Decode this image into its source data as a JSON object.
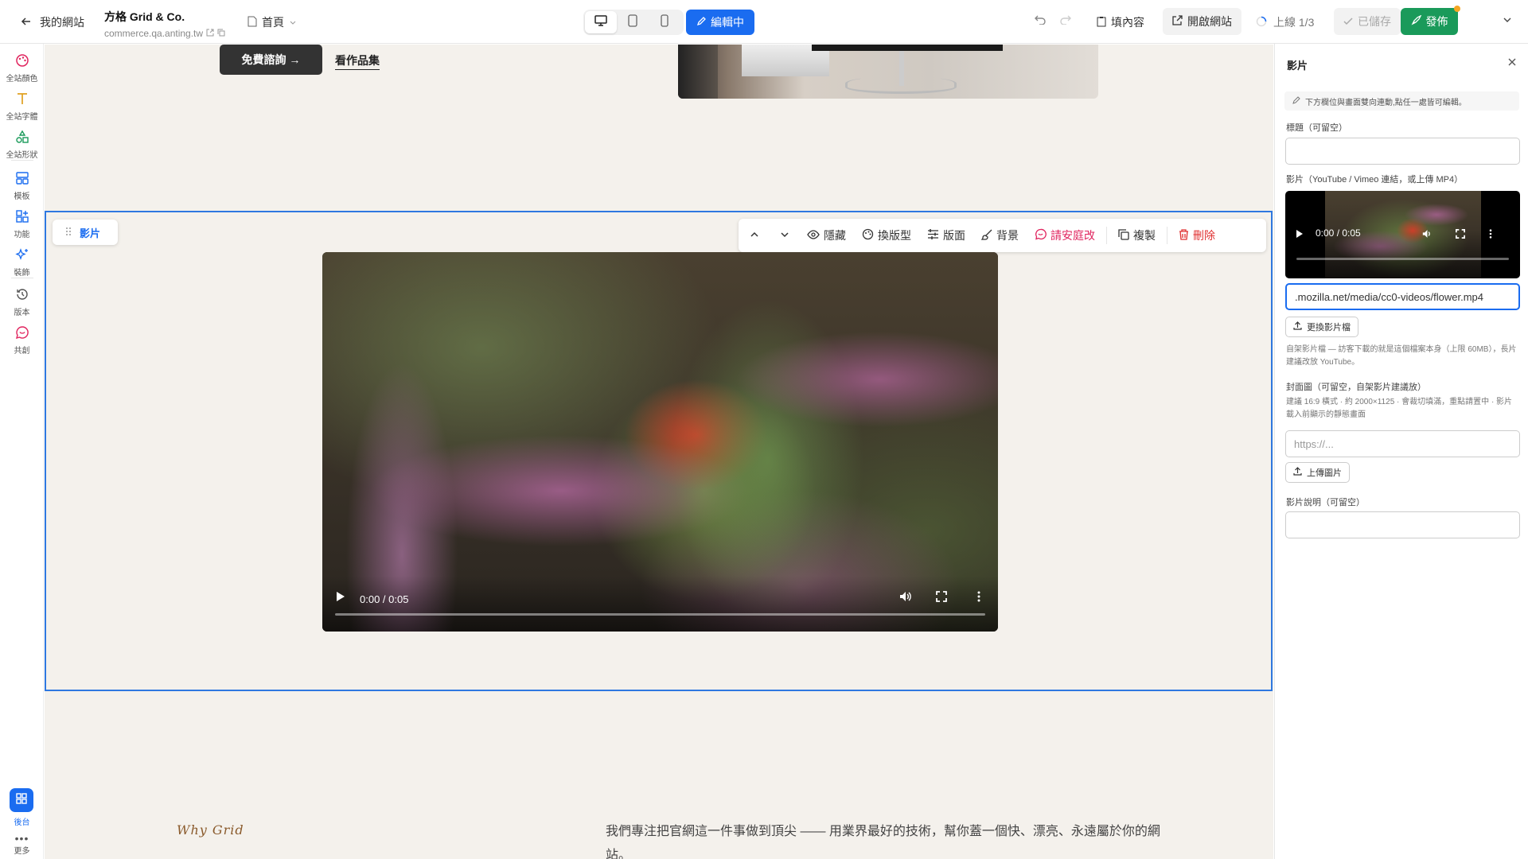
{
  "topbar": {
    "back_label": "我的網站",
    "site_name": "方格 Grid & Co.",
    "site_url": "commerce.qa.anting.tw",
    "page_label": "首頁",
    "edit_label": "編輯中",
    "fill_label": "填內容",
    "open_label": "開啟網站",
    "online_label": "上線 1/3",
    "saved_label": "已儲存",
    "publish_label": "發佈"
  },
  "sidebar": {
    "items": [
      {
        "label": "全站顏色",
        "icon": "palette-icon"
      },
      {
        "label": "全站字體",
        "icon": "type-icon"
      },
      {
        "label": "全站形狀",
        "icon": "shapes-icon"
      },
      {
        "label": "模板",
        "icon": "layout-icon"
      },
      {
        "label": "功能",
        "icon": "grid-plus-icon"
      },
      {
        "label": "裝飾",
        "icon": "sparkles-icon"
      },
      {
        "label": "版本",
        "icon": "history-icon"
      },
      {
        "label": "共創",
        "icon": "chat-icon"
      }
    ],
    "backend_label": "後台",
    "more_label": "更多"
  },
  "canvas": {
    "cta_label": "免費諮詢 →",
    "works_label": "看作品集",
    "section_tag": "影片",
    "toolbar": {
      "hide": "隱藏",
      "change_style": "換版型",
      "layout": "版面",
      "background": "背景",
      "ask": "請安庭改",
      "copy": "複製",
      "delete": "刪除"
    },
    "video_time": "0:00 / 0:05",
    "why_label": "Why Grid",
    "intro_text": "我們專注把官網這一件事做到頂尖 —— 用業界最好的技術，幫你蓋一個快、漂亮、永遠屬於你的網站。"
  },
  "panel": {
    "title": "影片",
    "hint": "下方欄位與畫面雙向連動,點任一處皆可編輯。",
    "title_label": "標題（可留空）",
    "title_value": "",
    "video_label": "影片（YouTube / Vimeo 連結，或上傳 MP4）",
    "video_time": "0:00 / 0:05",
    "video_url": ".mozilla.net/media/cc0-videos/flower.mp4",
    "replace_btn": "更換影片檔",
    "video_help": "自架影片檔 — 訪客下載的就是這個檔案本身（上限 60MB），長片建議改放 YouTube。",
    "cover_label": "封面圖（可留空，自架影片建議放）",
    "cover_help": "建議 16:9 橫式 · 約 2000×1125 · 會裁切填滿，重點請置中 · 影片載入前顯示的靜態畫面",
    "cover_placeholder": "https://...",
    "upload_btn": "上傳圖片",
    "caption_label": "影片說明（可留空）",
    "caption_value": ""
  },
  "colors": {
    "accent": "#1a6cf0",
    "publish": "#1a9a5a",
    "danger": "#e03030",
    "canvas_bg": "#f4f1ec"
  }
}
